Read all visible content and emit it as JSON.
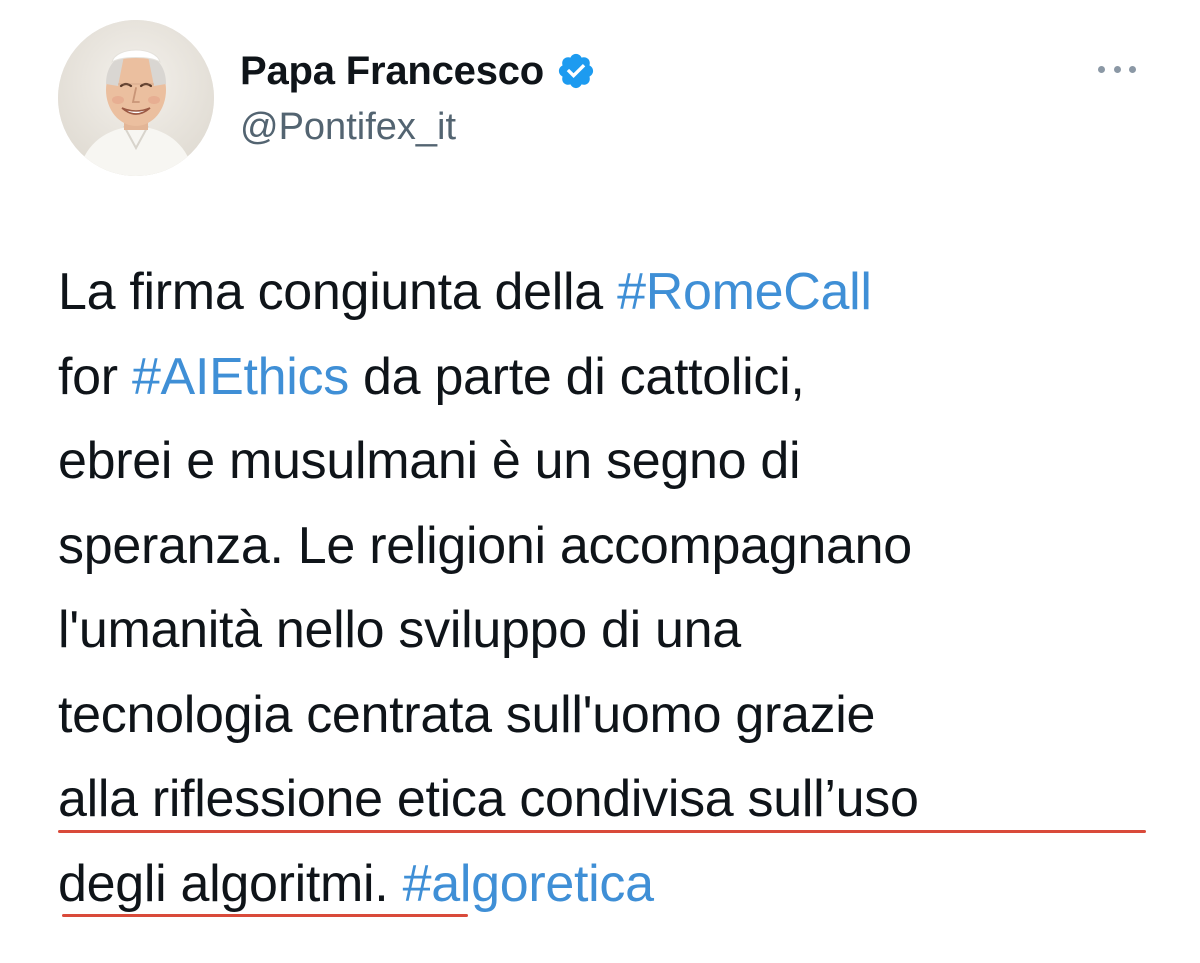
{
  "author": {
    "display_name": "Papa Francesco",
    "handle": "@Pontifex_it",
    "verified": true,
    "verified_color": "#1d9bf0"
  },
  "menu": {
    "icon": "more-horizontal-icon"
  },
  "tweet": {
    "line1_text": "La firma congiunta della ",
    "line1_hashtag": "#RomeCall",
    "line2_prefix": "for ",
    "line2_hashtag": "#AIEthics",
    "line2_suffix": " da parte di cattolici,",
    "line3": "ebrei e musulmani è un segno di",
    "line4": "speranza. Le religioni accompagnano",
    "line5": "l'umanità nello sviluppo di una",
    "line6": "tecnologia centrata sull'uomo grazie",
    "line7": "alla riflessione etica condivisa sull’uso",
    "line8_text": "degli algoritmi. ",
    "line8_hashtag": "#algoretica"
  },
  "colors": {
    "hashtag": "#3f8fd6",
    "text": "#0f1419",
    "secondary": "#536471",
    "annotation_underline": "#d94a3a"
  }
}
